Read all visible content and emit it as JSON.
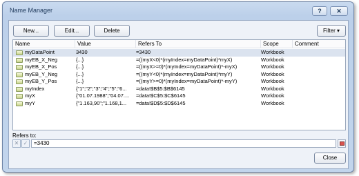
{
  "window": {
    "title": "Name Manager",
    "help_label": "?",
    "close_label": "✕"
  },
  "toolbar": {
    "new_label": "New...",
    "edit_label": "Edit...",
    "delete_label": "Delete",
    "filter_label": "Filter ▾"
  },
  "table": {
    "headers": [
      "Name",
      "Value",
      "Refers To",
      "Scope",
      "Comment"
    ],
    "rows": [
      {
        "name": "myDataPoint",
        "value": "3430",
        "refers": "=3430",
        "scope": "Workbook",
        "comment": ""
      },
      {
        "name": "myEB_X_Neg",
        "value": "{...}",
        "refers": "=((myX<0)*(myIndex=myDataPoint)*myX)",
        "scope": "Workbook",
        "comment": ""
      },
      {
        "name": "myEB_X_Pos",
        "value": "{...}",
        "refers": "=((myX>=0)*(myIndex=myDataPoint)*-myX)",
        "scope": "Workbook",
        "comment": ""
      },
      {
        "name": "myEB_Y_Neg",
        "value": "{...}",
        "refers": "=((myY<0)*(myIndex=myDataPoint)*myY)",
        "scope": "Workbook",
        "comment": ""
      },
      {
        "name": "myEB_Y_Pos",
        "value": "{...}",
        "refers": "=((myY>=0)*(myIndex=myDataPoint)*-myY)",
        "scope": "Workbook",
        "comment": ""
      },
      {
        "name": "myIndex",
        "value": "{\"1\";\"2\";\"3\";\"4\";\"5\";\"6...",
        "refers": "=data!$B$5:$B$6145",
        "scope": "Workbook",
        "comment": ""
      },
      {
        "name": "myX",
        "value": "{\"01.07.1988\";\"04.07....",
        "refers": "=data!$C$5:$C$6145",
        "scope": "Workbook",
        "comment": ""
      },
      {
        "name": "myY",
        "value": "{\"1.163,90\";\"1.168,1...",
        "refers": "=data!$D$5:$D$6145",
        "scope": "Workbook",
        "comment": ""
      }
    ]
  },
  "refers_to": {
    "label": "Refers to:",
    "value": "=3430",
    "cancel_icon": "✕",
    "ok_icon": "✓"
  },
  "footer": {
    "close_label": "Close"
  }
}
